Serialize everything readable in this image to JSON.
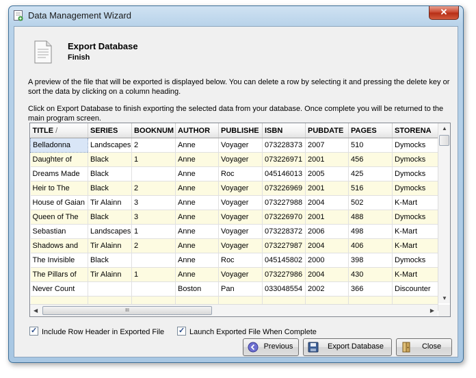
{
  "window": {
    "title": "Data Management Wizard",
    "close_glyph": "✕"
  },
  "header": {
    "title": "Export Database",
    "subtitle": "Finish",
    "icon": "document-icon"
  },
  "description": {
    "para1": "A preview of the file that will be exported is displayed below. You can delete a row by selecting it and pressing the delete key or sort the data by clicking on a column heading.",
    "para2": "Click on Export Database to finish exporting the selected data from your database. Once complete you will be returned to the main program screen."
  },
  "grid": {
    "columns": [
      "TITLE",
      "SERIES",
      "BOOKNUM",
      "AUTHOR",
      "PUBLISHE",
      "ISBN",
      "PUBDATE",
      "PAGES",
      "STORENA"
    ],
    "sort_indicator": "/",
    "rows": [
      [
        "Belladonna",
        "Landscapes",
        "2",
        "Anne",
        "Voyager",
        "073228373",
        "2007",
        "510",
        "Dymocks"
      ],
      [
        "Daughter of",
        "Black",
        "1",
        "Anne",
        "Voyager",
        "073226971",
        "2001",
        "456",
        "Dymocks"
      ],
      [
        "Dreams Made",
        "Black",
        "",
        "Anne",
        "Roc",
        "045146013",
        "2005",
        "425",
        "Dymocks"
      ],
      [
        "Heir to The",
        "Black",
        "2",
        "Anne",
        "Voyager",
        "073226969",
        "2001",
        "516",
        "Dymocks"
      ],
      [
        "House of Gaian",
        "Tir Alainn",
        "3",
        "Anne",
        "Voyager",
        "073227988",
        "2004",
        "502",
        "K-Mart"
      ],
      [
        "Queen of The",
        "Black",
        "3",
        "Anne",
        "Voyager",
        "073226970",
        "2001",
        "488",
        "Dymocks"
      ],
      [
        "Sebastian",
        "Landscapes",
        "1",
        "Anne",
        "Voyager",
        "073228372",
        "2006",
        "498",
        "K-Mart"
      ],
      [
        "Shadows and",
        "Tir Alainn",
        "2",
        "Anne",
        "Voyager",
        "073227987",
        "2004",
        "406",
        "K-Mart"
      ],
      [
        "The Invisible",
        "Black",
        "",
        "Anne",
        "Roc",
        "045145802",
        "2000",
        "398",
        "Dymocks"
      ],
      [
        "The Pillars of",
        "Tir Alainn",
        "1",
        "Anne",
        "Voyager",
        "073227986",
        "2004",
        "430",
        "K-Mart"
      ],
      [
        "Never Count",
        "",
        "",
        "Boston",
        "Pan",
        "033048554",
        "2002",
        "366",
        "Discounter"
      ],
      [
        "",
        "",
        "",
        "",
        "",
        "",
        "",
        "",
        ""
      ]
    ],
    "selected_row": 0,
    "scroll_grip": "III"
  },
  "options": {
    "include_row_header": {
      "label": "Include Row Header in Exported File",
      "checked": true
    },
    "launch_file": {
      "label": "Launch Exported File When Complete",
      "checked": true
    }
  },
  "buttons": {
    "previous": "Previous",
    "export": "Export Database",
    "close": "Close"
  }
}
